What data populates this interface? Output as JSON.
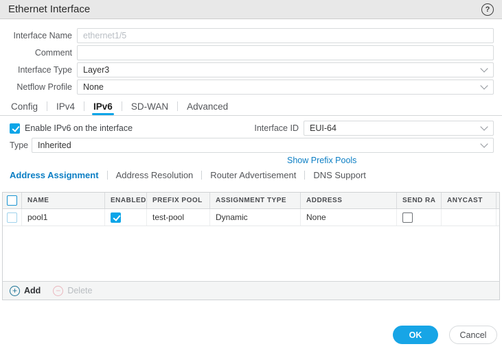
{
  "dialog": {
    "title": "Ethernet Interface"
  },
  "icons": {
    "help_glyph": "?",
    "add_glyph": "+",
    "delete_glyph": "−"
  },
  "form": {
    "interface_name": {
      "label": "Interface Name",
      "value": "ethernet1/5"
    },
    "comment": {
      "label": "Comment",
      "value": ""
    },
    "interface_type": {
      "label": "Interface Type",
      "value": "Layer3"
    },
    "netflow_profile": {
      "label": "Netflow Profile",
      "value": "None"
    }
  },
  "tabs": {
    "items": [
      "Config",
      "IPv4",
      "IPv6",
      "SD-WAN",
      "Advanced"
    ],
    "active": "IPv6"
  },
  "ipv6_panel": {
    "enable_label": "Enable IPv6 on the interface",
    "enable_checked": true,
    "interface_id": {
      "label": "Interface ID",
      "value": "EUI-64"
    },
    "type": {
      "label": "Type",
      "value": "Inherited"
    },
    "show_prefix_pools_link": "Show Prefix Pools",
    "subtabs": {
      "items": [
        "Address Assignment",
        "Address Resolution",
        "Router Advertisement",
        "DNS Support"
      ],
      "active": "Address Assignment"
    }
  },
  "table": {
    "columns": [
      "NAME",
      "ENABLED",
      "PREFIX POOL",
      "ASSIGNMENT TYPE",
      "ADDRESS",
      "SEND RA",
      "ANYCAST"
    ],
    "select_all_checked": false,
    "rows": [
      {
        "selected": false,
        "name": "pool1",
        "enabled": true,
        "prefix_pool": "test-pool",
        "assignment_type": "Dynamic",
        "address": "None",
        "send_ra": false,
        "anycast": ""
      }
    ],
    "toolbar": {
      "add": "Add",
      "delete": "Delete"
    }
  },
  "footer": {
    "ok": "OK",
    "cancel": "Cancel"
  },
  "colors": {
    "accent": "#0ba5e8",
    "link": "#0b7ec4",
    "ok_button": "#17a5e6",
    "titlebar_bg": "#e8e8e8"
  }
}
